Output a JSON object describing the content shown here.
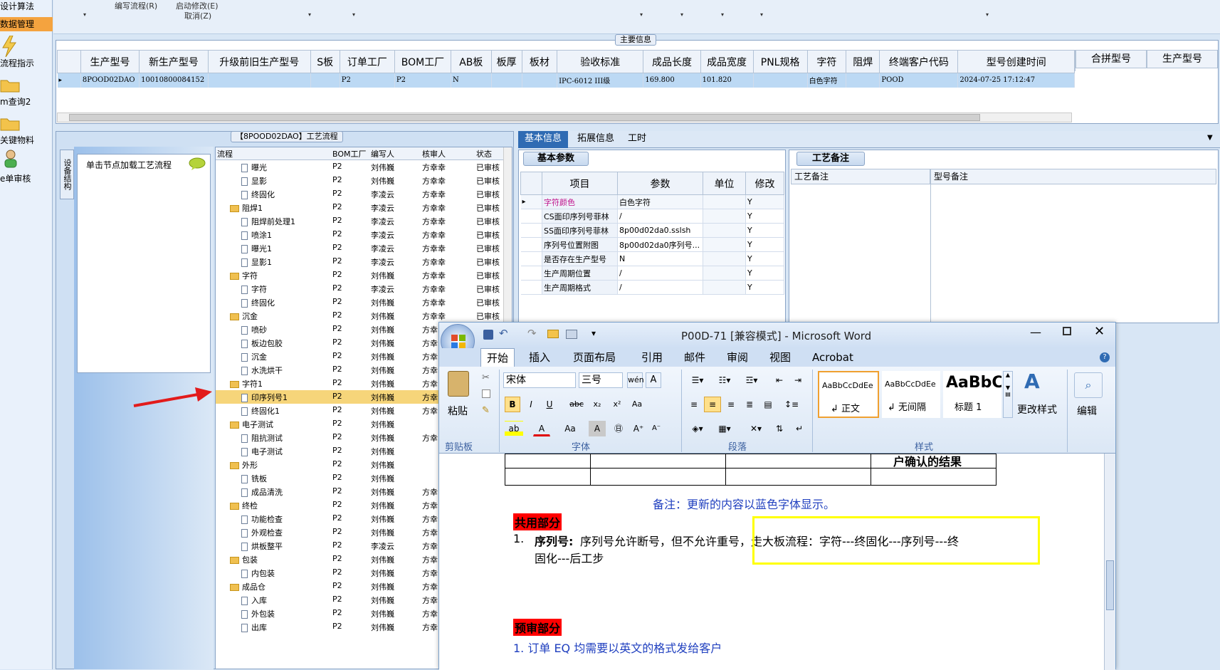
{
  "sidebar": {
    "items": [
      "设计算法",
      "数据管理",
      "流程指示",
      "m查询2",
      "关键物料",
      "e单审核"
    ],
    "selected": 1
  },
  "menu": {
    "edit_flow": "编写流程(R)",
    "start_modify": "启动修改(E)",
    "cancel": "取消(Z)"
  },
  "main_info": {
    "title": "主要信息",
    "columns": [
      "生产型号",
      "新生产型号",
      "升级前旧生产型号",
      "S板",
      "订单工厂",
      "BOM工厂",
      "AB板",
      "板厚",
      "板材",
      "验收标准",
      "成品长度",
      "成品宽度",
      "PNL规格",
      "字符",
      "阻焊",
      "终端客户代码",
      "型号创建时间"
    ],
    "row": [
      "8POOD02DAO",
      "10010800084152",
      "",
      "",
      "P2",
      "P2",
      "N",
      "",
      "",
      "IPC-6012 III级",
      "169.800",
      "101.820",
      "",
      "白色字符",
      "",
      "POOD",
      "2024-07-25 17:12:47"
    ],
    "side_columns": [
      "合拼型号",
      "生产型号"
    ]
  },
  "process_panel": {
    "title": "【8POOD02DAO】工艺流程",
    "side_tab": "设备结构",
    "hint": "单击节点加载工艺流程",
    "columns": [
      "流程",
      "BOM工厂",
      "编写人",
      "核审人",
      "状态"
    ],
    "rows": [
      {
        "name": "曝光",
        "bom": "P2",
        "writer": "刘伟巍",
        "reviewer": "方幸幸",
        "status": "已审核",
        "level": 2
      },
      {
        "name": "显影",
        "bom": "P2",
        "writer": "刘伟巍",
        "reviewer": "方幸幸",
        "status": "已审核",
        "level": 2
      },
      {
        "name": "终固化",
        "bom": "P2",
        "writer": "李凌云",
        "reviewer": "方幸幸",
        "status": "已审核",
        "level": 2
      },
      {
        "name": "阻焊1",
        "bom": "P2",
        "writer": "李凌云",
        "reviewer": "方幸幸",
        "status": "已审核",
        "level": 1
      },
      {
        "name": "阻焊前处理1",
        "bom": "P2",
        "writer": "李凌云",
        "reviewer": "方幸幸",
        "status": "已审核",
        "level": 2
      },
      {
        "name": "喷涂1",
        "bom": "P2",
        "writer": "李凌云",
        "reviewer": "方幸幸",
        "status": "已审核",
        "level": 2
      },
      {
        "name": "曝光1",
        "bom": "P2",
        "writer": "李凌云",
        "reviewer": "方幸幸",
        "status": "已审核",
        "level": 2
      },
      {
        "name": "显影1",
        "bom": "P2",
        "writer": "李凌云",
        "reviewer": "方幸幸",
        "status": "已审核",
        "level": 2
      },
      {
        "name": "字符",
        "bom": "P2",
        "writer": "刘伟巍",
        "reviewer": "方幸幸",
        "status": "已审核",
        "level": 1
      },
      {
        "name": "字符",
        "bom": "P2",
        "writer": "李凌云",
        "reviewer": "方幸幸",
        "status": "已审核",
        "level": 2
      },
      {
        "name": "终固化",
        "bom": "P2",
        "writer": "刘伟巍",
        "reviewer": "方幸幸",
        "status": "已审核",
        "level": 2
      },
      {
        "name": "沉金",
        "bom": "P2",
        "writer": "刘伟巍",
        "reviewer": "方幸幸",
        "status": "已审核",
        "level": 1
      },
      {
        "name": "喷砂",
        "bom": "P2",
        "writer": "刘伟巍",
        "reviewer": "方幸",
        "status": "",
        "level": 2
      },
      {
        "name": "板边包胶",
        "bom": "P2",
        "writer": "刘伟巍",
        "reviewer": "方幸",
        "status": "",
        "level": 2
      },
      {
        "name": "沉金",
        "bom": "P2",
        "writer": "刘伟巍",
        "reviewer": "方幸",
        "status": "",
        "level": 2
      },
      {
        "name": "水洗烘干",
        "bom": "P2",
        "writer": "刘伟巍",
        "reviewer": "方幸",
        "status": "",
        "level": 2
      },
      {
        "name": "字符1",
        "bom": "P2",
        "writer": "刘伟巍",
        "reviewer": "方幸",
        "status": "",
        "level": 1
      },
      {
        "name": "印序列号1",
        "bom": "P2",
        "writer": "刘伟巍",
        "reviewer": "方幸",
        "status": "",
        "level": 2,
        "selected": true
      },
      {
        "name": "终固化1",
        "bom": "P2",
        "writer": "刘伟巍",
        "reviewer": "方幸",
        "status": "",
        "level": 2
      },
      {
        "name": "电子测试",
        "bom": "P2",
        "writer": "刘伟巍",
        "reviewer": "",
        "status": "",
        "level": 1
      },
      {
        "name": "阻抗测试",
        "bom": "P2",
        "writer": "刘伟巍",
        "reviewer": "方幸",
        "status": "",
        "level": 2
      },
      {
        "name": "电子测试",
        "bom": "P2",
        "writer": "刘伟巍",
        "reviewer": "",
        "status": "",
        "level": 2
      },
      {
        "name": "外形",
        "bom": "P2",
        "writer": "刘伟巍",
        "reviewer": "",
        "status": "",
        "level": 1
      },
      {
        "name": "铣板",
        "bom": "P2",
        "writer": "刘伟巍",
        "reviewer": "",
        "status": "",
        "level": 2
      },
      {
        "name": "成品清洗",
        "bom": "P2",
        "writer": "刘伟巍",
        "reviewer": "方幸",
        "status": "",
        "level": 2
      },
      {
        "name": "终检",
        "bom": "P2",
        "writer": "刘伟巍",
        "reviewer": "方幸",
        "status": "",
        "level": 1
      },
      {
        "name": "功能检查",
        "bom": "P2",
        "writer": "刘伟巍",
        "reviewer": "方幸",
        "status": "",
        "level": 2
      },
      {
        "name": "外观检查",
        "bom": "P2",
        "writer": "刘伟巍",
        "reviewer": "方幸",
        "status": "",
        "level": 2
      },
      {
        "name": "烘板整平",
        "bom": "P2",
        "writer": "李凌云",
        "reviewer": "方幸",
        "status": "",
        "level": 2
      },
      {
        "name": "包装",
        "bom": "P2",
        "writer": "刘伟巍",
        "reviewer": "方幸",
        "status": "",
        "level": 1
      },
      {
        "name": "内包装",
        "bom": "P2",
        "writer": "刘伟巍",
        "reviewer": "方幸",
        "status": "",
        "level": 2
      },
      {
        "name": "成品仓",
        "bom": "P2",
        "writer": "刘伟巍",
        "reviewer": "方幸",
        "status": "",
        "level": 1
      },
      {
        "name": "入库",
        "bom": "P2",
        "writer": "刘伟巍",
        "reviewer": "方幸",
        "status": "",
        "level": 2
      },
      {
        "name": "外包装",
        "bom": "P2",
        "writer": "刘伟巍",
        "reviewer": "方幸",
        "status": "",
        "level": 2
      },
      {
        "name": "出库",
        "bom": "P2",
        "writer": "刘伟巍",
        "reviewer": "方幸",
        "status": "",
        "level": 2
      }
    ]
  },
  "right_tabs": [
    "基本信息",
    "拓展信息",
    "工时"
  ],
  "basic_params": {
    "title": "基本参数",
    "columns": [
      "项目",
      "参数",
      "单位",
      "修改"
    ],
    "rows": [
      [
        "字符颜色",
        "白色字符",
        "",
        "Y"
      ],
      [
        "CS面印序列号菲林",
        "/",
        "",
        "Y"
      ],
      [
        "SS面印序列号菲林",
        "8p00d02da0.sslsh",
        "",
        "Y"
      ],
      [
        "序列号位置附图",
        "8p00d02da0序列号...",
        "",
        "Y"
      ],
      [
        "是否存在生产型号",
        "N",
        "",
        "Y"
      ],
      [
        "生产周期位置",
        "/",
        "",
        "Y"
      ],
      [
        "生产周期格式",
        "/",
        "",
        "Y"
      ]
    ]
  },
  "remarks": {
    "title": "工艺备注",
    "col1": "工艺备注",
    "col2": "型号备注"
  },
  "word": {
    "title": "P00D-71 [兼容模式] - Microsoft Word",
    "tabs": [
      "开始",
      "插入",
      "页面布局",
      "引用",
      "邮件",
      "审阅",
      "视图",
      "Acrobat"
    ],
    "font_name": "宋体",
    "font_size": "三号",
    "styles": [
      {
        "sample": "AaBbCcDdEe",
        "name": "↲ 正文"
      },
      {
        "sample": "AaBbCcDdEe",
        "name": "↲ 无间隔"
      },
      {
        "sample": "AaBbC",
        "name": "标题 1"
      }
    ],
    "groups": [
      "剪贴板",
      "字体",
      "段落",
      "样式"
    ],
    "paste": "粘贴",
    "change_styles": "更改样式",
    "edit": "编辑",
    "doc": {
      "cell_text": "户确认的结果",
      "note": "备注：更新的内容以蓝色字体显示。",
      "shared": "共用部分",
      "item1_num": "1.",
      "item1_bold": "序列号:",
      "item1_text": "序列号允许断号，但不允许重号，走大板流程：字符---终固化---序列号---终",
      "item1_cont": "固化---后工步",
      "prereview": "预审部分",
      "item2": "1.  订单 EQ 均需要以英文的格式发给客户"
    }
  }
}
